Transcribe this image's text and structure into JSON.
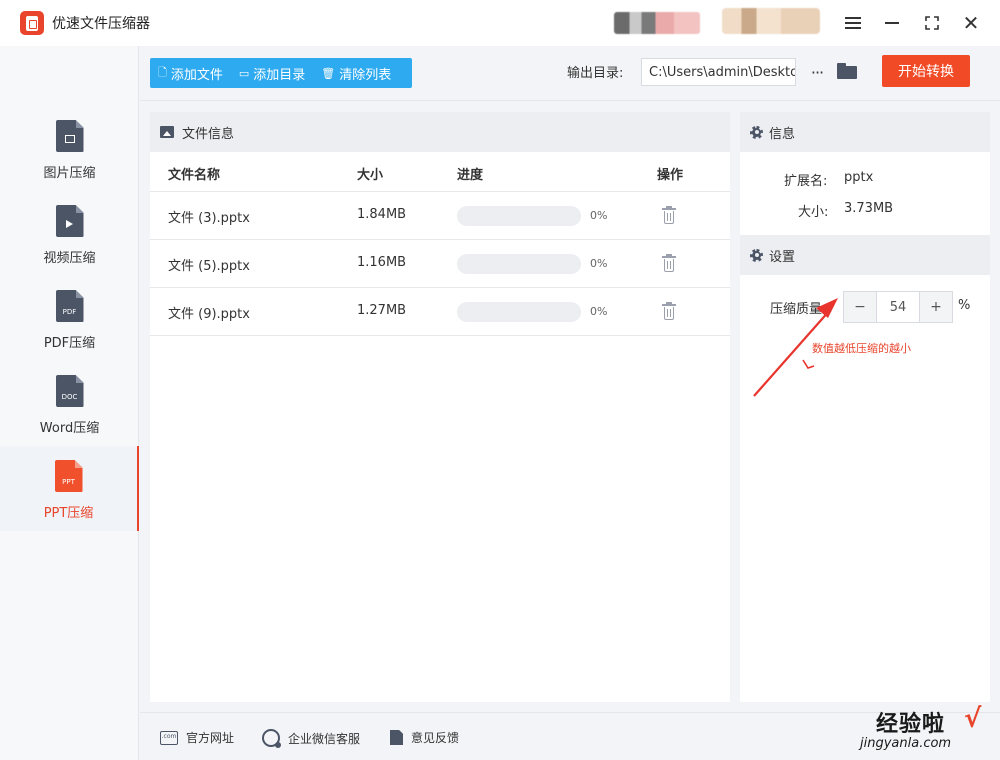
{
  "app": {
    "title": "优速文件压缩器"
  },
  "sidebar": {
    "items": [
      {
        "label": "图片压缩",
        "icon": "image-file-icon"
      },
      {
        "label": "视频压缩",
        "icon": "video-file-icon"
      },
      {
        "label": "PDF压缩",
        "icon": "pdf-file-icon",
        "tag": "PDF"
      },
      {
        "label": "Word压缩",
        "icon": "doc-file-icon",
        "tag": "DOC"
      },
      {
        "label": "PPT压缩",
        "icon": "ppt-file-icon",
        "tag": "PPT",
        "active": true
      }
    ]
  },
  "toolbar": {
    "add_file": "添加文件",
    "add_dir": "添加目录",
    "clear_list": "清除列表",
    "output_label": "输出目录:",
    "output_path": "C:\\Users\\admin\\Desktop",
    "dots": "···",
    "start_button": "开始转换"
  },
  "file_panel": {
    "title": "文件信息",
    "columns": {
      "name": "文件名称",
      "size": "大小",
      "progress": "进度",
      "action": "操作"
    },
    "rows": [
      {
        "name": "文件 (3).pptx",
        "size": "1.84MB",
        "progress": 0,
        "progress_text": "0%"
      },
      {
        "name": "文件 (5).pptx",
        "size": "1.16MB",
        "progress": 0,
        "progress_text": "0%"
      },
      {
        "name": "文件 (9).pptx",
        "size": "1.27MB",
        "progress": 0,
        "progress_text": "0%"
      }
    ]
  },
  "info_panel": {
    "title": "信息",
    "ext_label": "扩展名:",
    "ext_value": "pptx",
    "size_label": "大小:",
    "size_value": "3.73MB"
  },
  "settings_panel": {
    "title": "设置",
    "quality_label": "压缩质量:",
    "minus": "−",
    "plus": "+",
    "quality_value": "54",
    "unit": "%",
    "hint": "数值越低压缩的越小"
  },
  "bottom": {
    "website": "官方网址",
    "wechat": "企业微信客服",
    "feedback": "意见反馈",
    "com_icon_text": ".com"
  },
  "watermark": {
    "title": "经验啦",
    "check": "√",
    "url": "jingyanla.com"
  },
  "colors": {
    "accent": "#e8452c",
    "primary": "#2eaaf0",
    "dark_icon": "#4b5566"
  }
}
